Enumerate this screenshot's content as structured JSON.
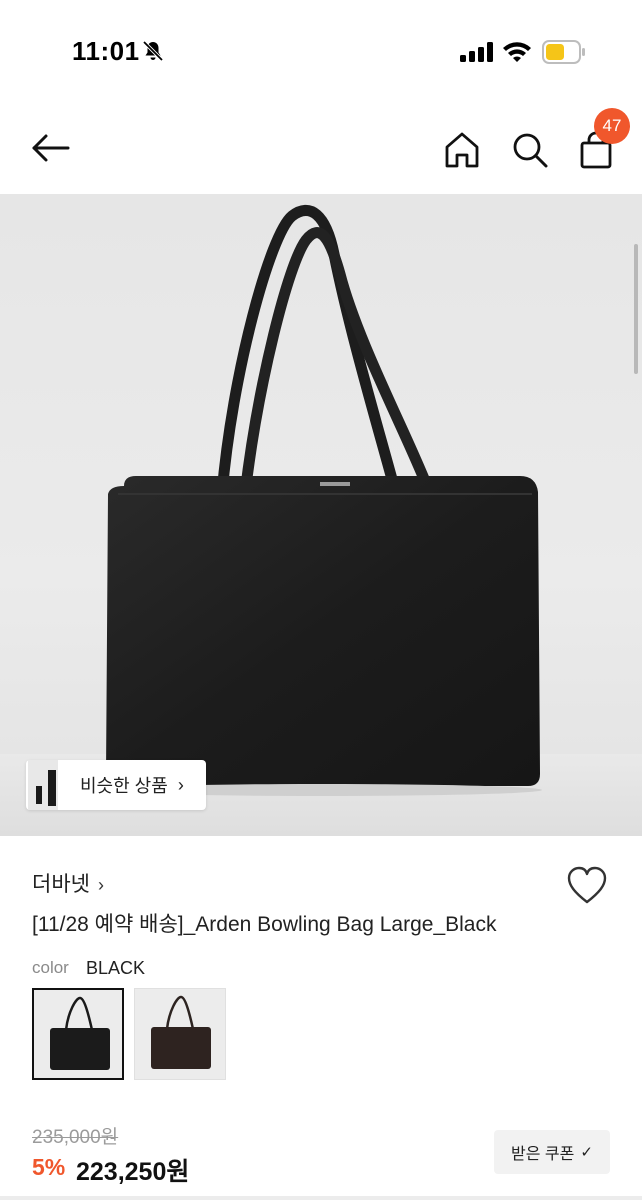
{
  "status_bar": {
    "time": "11:01",
    "icons": [
      "bell-slash-icon",
      "signal-icon",
      "wifi-icon",
      "battery-icon"
    ],
    "battery_color": "#f5c518"
  },
  "header": {
    "icons": [
      "arrow-left-icon",
      "home-icon",
      "search-icon",
      "shopping-bag-icon"
    ],
    "cart_count": "47",
    "badge_color": "#f0572c"
  },
  "hero": {
    "similar_label": "비슷한 상품",
    "similar_chevron": "›"
  },
  "product": {
    "brand": "더바넷",
    "brand_chevron": "›",
    "title": "[11/28 예약 배송]_Arden Bowling Bag Large_Black",
    "color_label": "color",
    "color_value": "BLACK",
    "swatches": [
      {
        "name": "Black",
        "selected": true
      },
      {
        "name": "Brown",
        "selected": false
      }
    ]
  },
  "pricing": {
    "original_price": "235,000원",
    "discount": "5%",
    "sale_price": "223,250원",
    "coupon_label": "받은 쿠폰",
    "coupon_check": "✓",
    "accent_color": "#f0572c"
  }
}
